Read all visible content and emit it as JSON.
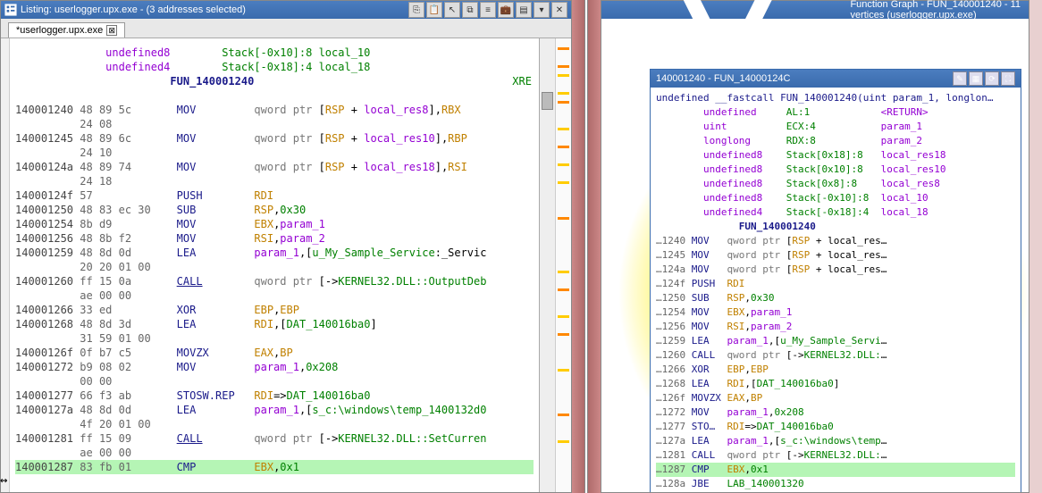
{
  "listing": {
    "title": "Listing: userlogger.upx.exe - (3 addresses selected)",
    "tab": "*userlogger.upx.exe",
    "toolbar_icons": [
      "copy",
      "paste",
      "cursor",
      "sep",
      "tree",
      "list",
      "brief",
      "case",
      "sep",
      "menu",
      "close"
    ],
    "header": {
      "l1": {
        "type": "undefined8",
        "stack": "Stack[-0x10]:8",
        "name": "local_10"
      },
      "l2": {
        "type": "undefined4",
        "stack": "Stack[-0x18]:4",
        "name": "local_18"
      },
      "fun": "FUN_140001240",
      "xref": "XRE"
    },
    "rows": [
      {
        "a": "140001240",
        "b": "48 89 5c",
        "m": "MOV",
        "o": "qword ptr [RSP + local_res8],RBX"
      },
      {
        "a": "",
        "b": "24 08",
        "m": "",
        "o": ""
      },
      {
        "a": "140001245",
        "b": "48 89 6c",
        "m": "MOV",
        "o": "qword ptr [RSP + local_res10],RBP"
      },
      {
        "a": "",
        "b": "24 10",
        "m": "",
        "o": ""
      },
      {
        "a": "14000124a",
        "b": "48 89 74",
        "m": "MOV",
        "o": "qword ptr [RSP + local_res18],RSI"
      },
      {
        "a": "",
        "b": "24 18",
        "m": "",
        "o": ""
      },
      {
        "a": "14000124f",
        "b": "57",
        "m": "PUSH",
        "o": "RDI"
      },
      {
        "a": "140001250",
        "b": "48 83 ec 30",
        "m": "SUB",
        "o": "RSP,0x30"
      },
      {
        "a": "140001254",
        "b": "8b d9",
        "m": "MOV",
        "o": "EBX,param_1"
      },
      {
        "a": "140001256",
        "b": "48 8b f2",
        "m": "MOV",
        "o": "RSI,param_2"
      },
      {
        "a": "140001259",
        "b": "48 8d 0d",
        "m": "LEA",
        "o": "param_1,[u_My_Sample_Service:_Servic"
      },
      {
        "a": "",
        "b": "20 20 01 00",
        "m": "",
        "o": ""
      },
      {
        "a": "140001260",
        "b": "ff 15 0a",
        "m": "CALL",
        "o": "qword ptr [->KERNEL32.DLL::OutputDeb",
        "und": true
      },
      {
        "a": "",
        "b": "ae 00 00",
        "m": "",
        "o": ""
      },
      {
        "a": "140001266",
        "b": "33 ed",
        "m": "XOR",
        "o": "EBP,EBP"
      },
      {
        "a": "140001268",
        "b": "48 8d 3d",
        "m": "LEA",
        "o": "RDI,[DAT_140016ba0]"
      },
      {
        "a": "",
        "b": "31 59 01 00",
        "m": "",
        "o": ""
      },
      {
        "a": "14000126f",
        "b": "0f b7 c5",
        "m": "MOVZX",
        "o": "EAX,BP"
      },
      {
        "a": "140001272",
        "b": "b9 08 02",
        "m": "MOV",
        "o": "param_1,0x208"
      },
      {
        "a": "",
        "b": "00 00",
        "m": "",
        "o": ""
      },
      {
        "a": "140001277",
        "b": "66 f3 ab",
        "m": "STOSW.REP",
        "o": "RDI=>DAT_140016ba0"
      },
      {
        "a": "14000127a",
        "b": "48 8d 0d",
        "m": "LEA",
        "o": "param_1,[s_c:\\windows\\temp_1400132d0"
      },
      {
        "a": "",
        "b": "4f 20 01 00",
        "m": "",
        "o": ""
      },
      {
        "a": "140001281",
        "b": "ff 15 09",
        "m": "CALL",
        "o": "qword ptr [->KERNEL32.DLL::SetCurren",
        "und": true
      },
      {
        "a": "",
        "b": "ae 00 00",
        "m": "",
        "o": ""
      },
      {
        "a": "140001287",
        "b": "83 fb 01",
        "m": "CMP",
        "o": "EBX,0x1",
        "hl": true
      }
    ]
  },
  "graph": {
    "title": "Function Graph - FUN_140001240 - 11 vertices  (userlogger.upx.exe)",
    "node": {
      "title": "140001240 - FUN_14000124C",
      "tools": [
        "edit",
        "sep",
        "grid",
        "refresh",
        "full"
      ],
      "sig": "undefined __fastcall FUN_140001240(uint param_1, longlon…",
      "params": [
        {
          "type": "undefined",
          "loc": "AL:1",
          "name": "<RETURN>"
        },
        {
          "type": "uint",
          "loc": "ECX:4",
          "name": "param_1"
        },
        {
          "type": "longlong",
          "loc": "RDX:8",
          "name": "param_2"
        },
        {
          "type": "undefined8",
          "loc": "Stack[0x18]:8",
          "name": "local_res18"
        },
        {
          "type": "undefined8",
          "loc": "Stack[0x10]:8",
          "name": "local_res10"
        },
        {
          "type": "undefined8",
          "loc": "Stack[0x8]:8",
          "name": "local_res8"
        },
        {
          "type": "undefined8",
          "loc": "Stack[-0x10]:8",
          "name": "local_10"
        },
        {
          "type": "undefined4",
          "loc": "Stack[-0x18]:4",
          "name": "local_18"
        }
      ],
      "fun": "FUN_140001240",
      "instr": [
        {
          "a": "…1240",
          "m": "MOV",
          "o": "qword ptr [RSP + local_res…"
        },
        {
          "a": "…1245",
          "m": "MOV",
          "o": "qword ptr [RSP + local_res…"
        },
        {
          "a": "…124a",
          "m": "MOV",
          "o": "qword ptr [RSP + local_res…"
        },
        {
          "a": "…124f",
          "m": "PUSH",
          "o": "RDI"
        },
        {
          "a": "…1250",
          "m": "SUB",
          "o": "RSP,0x30"
        },
        {
          "a": "…1254",
          "m": "MOV",
          "o": "EBX,param_1"
        },
        {
          "a": "…1256",
          "m": "MOV",
          "o": "RSI,param_2"
        },
        {
          "a": "…1259",
          "m": "LEA",
          "o": "param_1,[u_My_Sample_Servi…"
        },
        {
          "a": "…1260",
          "m": "CALL",
          "o": "qword ptr [->KERNEL32.DLL:…"
        },
        {
          "a": "…1266",
          "m": "XOR",
          "o": "EBP,EBP"
        },
        {
          "a": "…1268",
          "m": "LEA",
          "o": "RDI,[DAT_140016ba0]"
        },
        {
          "a": "…126f",
          "m": "MOVZX",
          "o": "EAX,BP"
        },
        {
          "a": "…1272",
          "m": "MOV",
          "o": "param_1,0x208"
        },
        {
          "a": "…1277",
          "m": "STO…",
          "o": "RDI=>DAT_140016ba0"
        },
        {
          "a": "…127a",
          "m": "LEA",
          "o": "param_1,[s_c:\\windows\\temp…"
        },
        {
          "a": "…1281",
          "m": "CALL",
          "o": "qword ptr [->KERNEL32.DLL:…"
        },
        {
          "a": "…1287",
          "m": "CMP",
          "o": "EBX,0x1",
          "hl": true
        },
        {
          "a": "…128a",
          "m": "JBE",
          "o": "LAB_140001320"
        }
      ]
    }
  }
}
